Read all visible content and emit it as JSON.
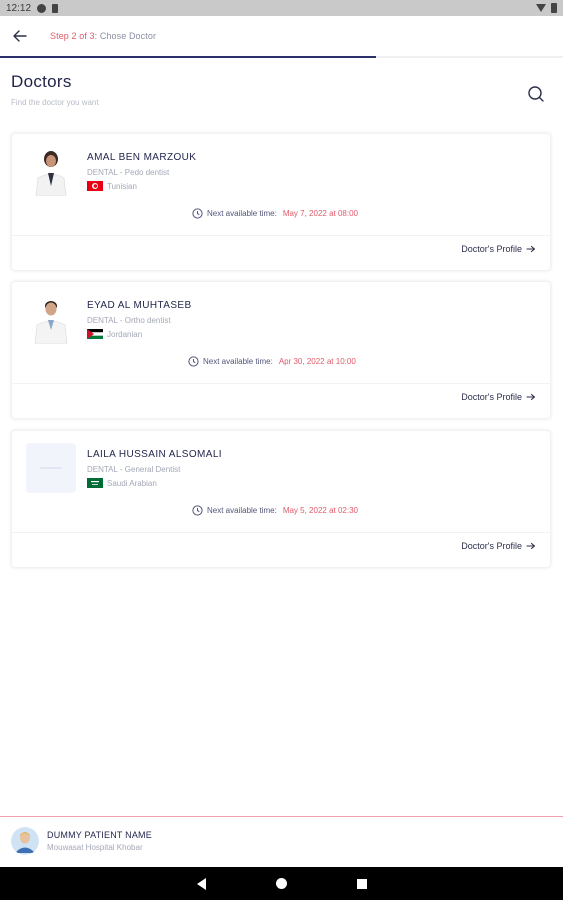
{
  "status_bar": {
    "time": "12:12"
  },
  "header": {
    "step_prefix": "Step 2 of 3:",
    "step_label": "Chose Doctor",
    "progress": 0.667
  },
  "page": {
    "title": "Doctors",
    "subtitle": "Find the doctor you want"
  },
  "doctors": [
    {
      "name": "AMAL BEN MARZOUK",
      "specialty": "DENTAL - Pedo dentist",
      "nationality": "Tunisian",
      "flag": "tunisia",
      "next_label": "Next available time:",
      "next_time": "May 7, 2022 at 08:00",
      "profile_label": "Doctor's Profile"
    },
    {
      "name": "EYAD AL MUHTASEB",
      "specialty": "DENTAL - Ortho dentist",
      "nationality": "Jordanian",
      "flag": "jordan",
      "next_label": "Next available time:",
      "next_time": "Apr 30, 2022 at 10:00",
      "profile_label": "Doctor's Profile"
    },
    {
      "name": "LAILA HUSSAIN ALSOMALI",
      "specialty": "DENTAL - General Dentist",
      "nationality": "Saudi Arabian",
      "flag": "saudi",
      "next_label": "Next available time:",
      "next_time": "May 5, 2022 at 02:30",
      "profile_label": "Doctor's Profile"
    }
  ],
  "patient": {
    "name": "DUMMY PATIENT NAME",
    "hospital": "Mouwasat Hospital Khobar"
  },
  "colors": {
    "accent": "#e05a6a",
    "primary": "#2b2f6a",
    "muted": "#a4a8b8"
  }
}
